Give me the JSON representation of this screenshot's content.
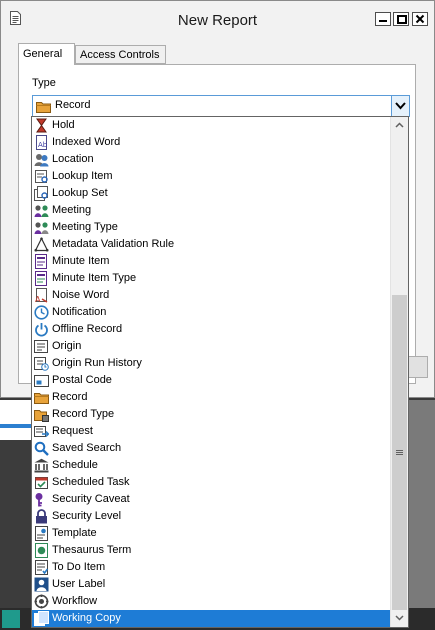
{
  "window": {
    "title": "New Report"
  },
  "tabs": [
    {
      "label": "General",
      "active": true
    },
    {
      "label": "Access Controls",
      "active": false
    }
  ],
  "type_field": {
    "label": "Type",
    "value": "Record",
    "value_icon": "folder-icon"
  },
  "dropdown": {
    "selected": "Working Copy",
    "items": [
      {
        "label": "Hold",
        "icon": "hourglass-icon"
      },
      {
        "label": "Indexed Word",
        "icon": "document-text-icon"
      },
      {
        "label": "Location",
        "icon": "people-icon"
      },
      {
        "label": "Lookup Item",
        "icon": "lookup-item-icon"
      },
      {
        "label": "Lookup Set",
        "icon": "lookup-set-icon"
      },
      {
        "label": "Meeting",
        "icon": "meeting-icon"
      },
      {
        "label": "Meeting Type",
        "icon": "meeting-type-icon"
      },
      {
        "label": "Metadata Validation Rule",
        "icon": "triangle-rule-icon"
      },
      {
        "label": "Minute Item",
        "icon": "minute-item-icon"
      },
      {
        "label": "Minute Item Type",
        "icon": "minute-item-type-icon"
      },
      {
        "label": "Noise Word",
        "icon": "noise-word-icon"
      },
      {
        "label": "Notification",
        "icon": "clock-icon"
      },
      {
        "label": "Offline Record",
        "icon": "power-icon"
      },
      {
        "label": "Origin",
        "icon": "origin-icon"
      },
      {
        "label": "Origin Run History",
        "icon": "origin-history-icon"
      },
      {
        "label": "Postal Code",
        "icon": "postal-code-icon"
      },
      {
        "label": "Record",
        "icon": "folder-icon"
      },
      {
        "label": "Record Type",
        "icon": "record-type-icon"
      },
      {
        "label": "Request",
        "icon": "request-icon"
      },
      {
        "label": "Saved Search",
        "icon": "search-icon"
      },
      {
        "label": "Schedule",
        "icon": "building-icon"
      },
      {
        "label": "Scheduled Task",
        "icon": "scheduled-task-icon"
      },
      {
        "label": "Security Caveat",
        "icon": "key-icon"
      },
      {
        "label": "Security Level",
        "icon": "lock-icon"
      },
      {
        "label": "Template",
        "icon": "template-icon"
      },
      {
        "label": "Thesaurus Term",
        "icon": "thesaurus-icon"
      },
      {
        "label": "To Do Item",
        "icon": "todo-icon"
      },
      {
        "label": "User Label",
        "icon": "user-label-icon"
      },
      {
        "label": "Workflow",
        "icon": "workflow-icon"
      },
      {
        "label": "Working Copy",
        "icon": "working-copy-icon"
      }
    ]
  },
  "colors": {
    "selection": "#1e7cd6",
    "focus_border": "#5a9bd8"
  }
}
